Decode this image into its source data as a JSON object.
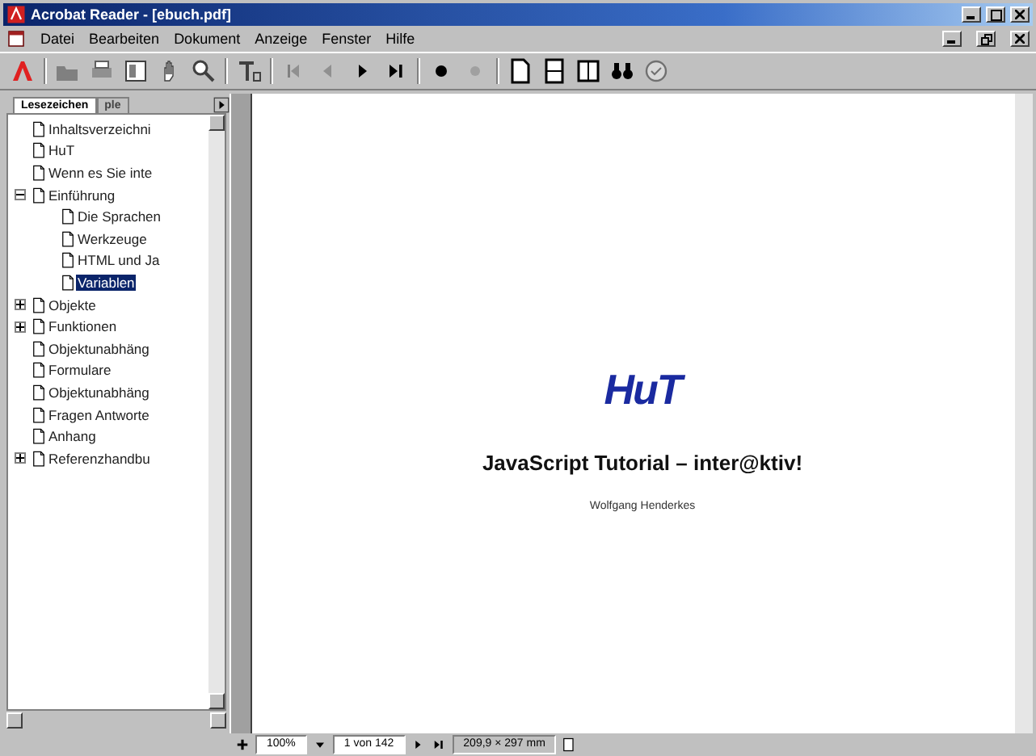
{
  "window": {
    "title": "Acrobat Reader - [ebuch.pdf]"
  },
  "menu": [
    "Datei",
    "Bearbeiten",
    "Dokument",
    "Anzeige",
    "Fenster",
    "Hilfe"
  ],
  "sidebar": {
    "tabs": [
      {
        "label": "Lesezeichen",
        "selected": true
      },
      {
        "label": "ple",
        "selected": false
      }
    ],
    "items": [
      {
        "label": "Inhaltsverzeichni",
        "selected": false
      },
      {
        "label": "HuT",
        "selected": false
      },
      {
        "label": "Wenn es Sie inte",
        "selected": false
      },
      {
        "label": "Einführung",
        "selected": false,
        "expanded": true,
        "children": [
          {
            "label": "Die Sprachen",
            "selected": false
          },
          {
            "label": "Werkzeuge",
            "selected": false
          },
          {
            "label": "HTML und Ja",
            "selected": false
          },
          {
            "label": "Variablen",
            "selected": true
          }
        ]
      },
      {
        "label": "Objekte",
        "selected": false,
        "expanded": false
      },
      {
        "label": "Funktionen",
        "selected": false,
        "expanded": false
      },
      {
        "label": "Objektunabhäng",
        "selected": false
      },
      {
        "label": "Formulare",
        "selected": false
      },
      {
        "label": "Objektunabhäng",
        "selected": false
      },
      {
        "label": "Fragen Antworte",
        "selected": false
      },
      {
        "label": "Anhang",
        "selected": false
      },
      {
        "label": "Referenzhandbu",
        "selected": false,
        "expanded": false
      }
    ]
  },
  "document": {
    "logo": "HuT",
    "title": "JavaScript Tutorial – inter@ktiv!",
    "author": "Wolfgang Henderkes"
  },
  "status_bar": {
    "zoom": "100%",
    "page": "1 von 142",
    "size": "209,9 × 297 mm"
  }
}
